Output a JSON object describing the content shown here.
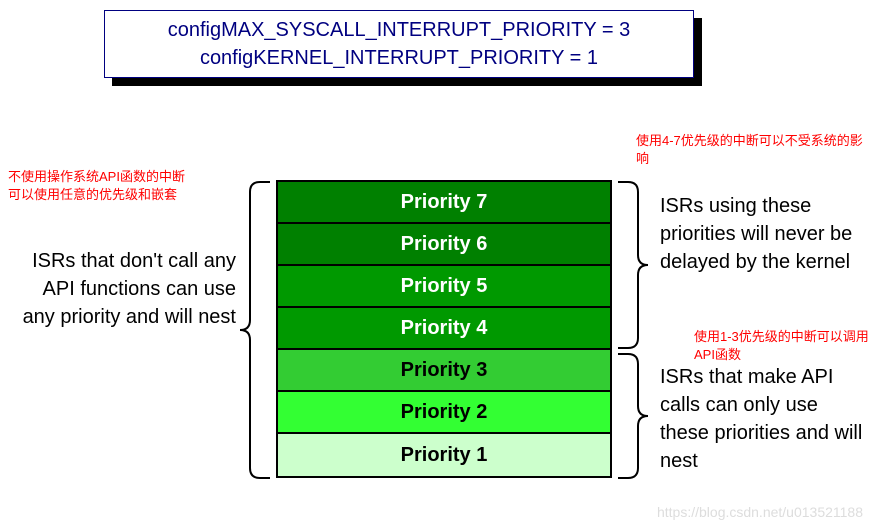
{
  "config": {
    "line1": "configMAX_SYSCALL_INTERRUPT_PRIORITY = 3",
    "line2": "configKERNEL_INTERRUPT_PRIORITY = 1"
  },
  "annotations": {
    "topleft": "不使用操作系统API函数的中断可以使用任意的优先级和嵌套",
    "topright": "使用4-7优先级的中断可以不受系统的影响",
    "right2": "使用1-3优先级的中断可以调用API函数"
  },
  "descriptions": {
    "left": "ISRs that don't call any API functions can use any priority and will nest",
    "right1": "ISRs using these priorities will never be delayed by the kernel",
    "right2": "ISRs that make API calls can only use these priorities and will nest"
  },
  "priorities": [
    {
      "label": "Priority 7",
      "level": 7
    },
    {
      "label": "Priority 6",
      "level": 6
    },
    {
      "label": "Priority 5",
      "level": 5
    },
    {
      "label": "Priority 4",
      "level": 4
    },
    {
      "label": "Priority 3",
      "level": 3
    },
    {
      "label": "Priority 2",
      "level": 2
    },
    {
      "label": "Priority 1",
      "level": 1
    }
  ],
  "watermark": "https://blog.csdn.net/u013521188",
  "chart_data": {
    "type": "table",
    "title": "FreeRTOS Interrupt Priority Configuration",
    "config_max_syscall_interrupt_priority": 3,
    "config_kernel_interrupt_priority": 1,
    "priority_levels": [
      7,
      6,
      5,
      4,
      3,
      2,
      1
    ],
    "groups": [
      {
        "range": [
          4,
          7
        ],
        "description": "ISRs using these priorities will never be delayed by the kernel",
        "can_call_api": false
      },
      {
        "range": [
          1,
          3
        ],
        "description": "ISRs that make API calls can only use these priorities and will nest",
        "can_call_api": true
      }
    ],
    "note_all": "ISRs that don't call any API functions can use any priority and will nest"
  }
}
